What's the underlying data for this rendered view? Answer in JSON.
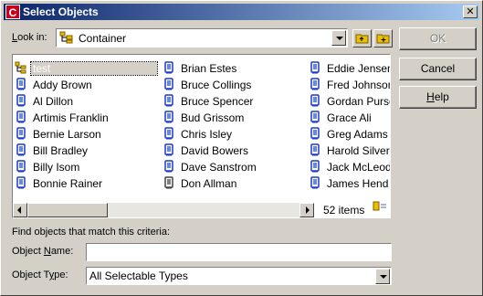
{
  "window": {
    "title": "Select Objects",
    "app_icon_letter": "C"
  },
  "look_in": {
    "label_prefix": "",
    "label_key": "L",
    "label_rest": "ook in:",
    "value": "Container"
  },
  "buttons": {
    "ok": "OK",
    "cancel": "Cancel",
    "help_key": "H",
    "help_rest": "elp"
  },
  "list": {
    "items": [
      {
        "label": "test",
        "icon": "container-icon"
      },
      {
        "label": "Addy Brown",
        "icon": "user-icon"
      },
      {
        "label": "Al Dillon",
        "icon": "user-icon"
      },
      {
        "label": "Artimis Franklin",
        "icon": "user-icon"
      },
      {
        "label": "Bernie Larson",
        "icon": "user-icon"
      },
      {
        "label": "Bill Bradley",
        "icon": "user-icon"
      },
      {
        "label": "Billy Isom",
        "icon": "user-icon"
      },
      {
        "label": "Bonnie Rainer",
        "icon": "user-icon"
      },
      {
        "label": "Brian Estes",
        "icon": "user-icon"
      },
      {
        "label": "Bruce Collings",
        "icon": "user-icon"
      },
      {
        "label": "Bruce Spencer",
        "icon": "user-icon"
      },
      {
        "label": "Bud Grissom",
        "icon": "user-icon"
      },
      {
        "label": "Chris Isley",
        "icon": "user-icon"
      },
      {
        "label": "David Bowers",
        "icon": "user-icon"
      },
      {
        "label": "Dave Sanstrom",
        "icon": "user-icon"
      },
      {
        "label": "Don Allman",
        "icon": "user-disabled-icon"
      },
      {
        "label": "Eddie Jensen",
        "icon": "user-icon"
      },
      {
        "label": "Fred Johnson",
        "icon": "user-icon"
      },
      {
        "label": "Gordan Purse",
        "icon": "user-icon"
      },
      {
        "label": "Grace Ali",
        "icon": "user-icon"
      },
      {
        "label": "Greg Adams",
        "icon": "user-icon"
      },
      {
        "label": "Harold Silver",
        "icon": "user-icon"
      },
      {
        "label": "Jack McLeod",
        "icon": "user-icon"
      },
      {
        "label": "James Hend",
        "icon": "user-icon"
      }
    ],
    "count": "52 items"
  },
  "criteria": {
    "heading": "Find objects that match this criteria:",
    "name_label_pre": "Object ",
    "name_label_key": "N",
    "name_label_post": "ame:",
    "name_value": "",
    "type_label_pre": "Object T",
    "type_label_key": "y",
    "type_label_post": "pe:",
    "type_value": "All Selectable Types"
  },
  "colors": {
    "titlebar_start": "#0a246a",
    "titlebar_end": "#a6caf0",
    "face": "#d4d0c8"
  }
}
